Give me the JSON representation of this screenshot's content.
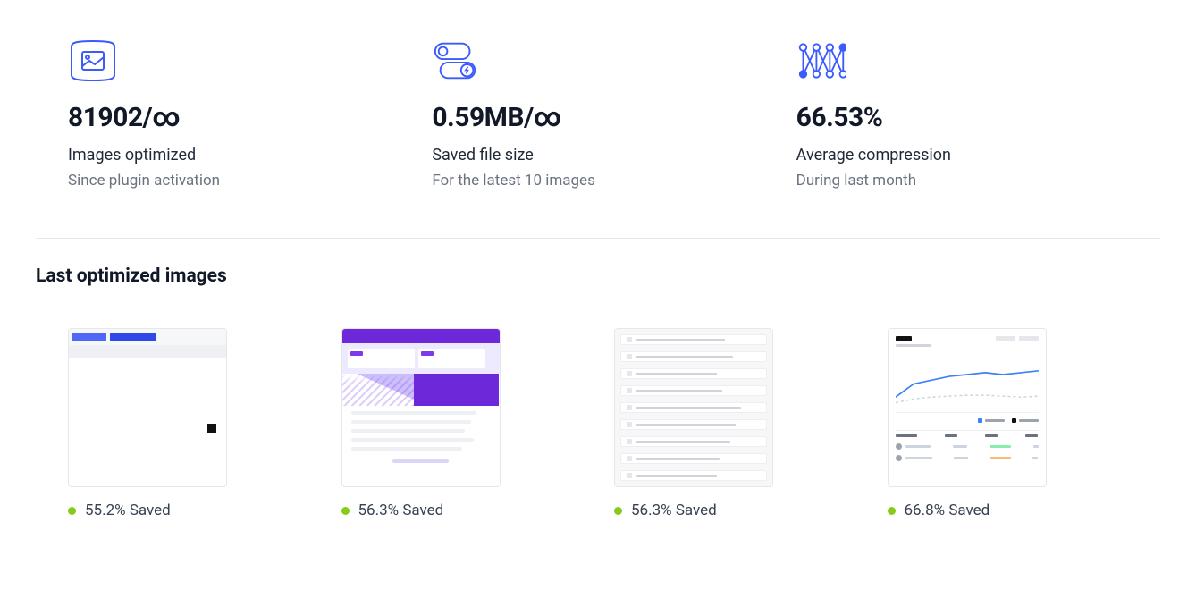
{
  "stats": [
    {
      "value": "81902/∞",
      "label": "Images optimized",
      "sub": "Since plugin activation",
      "icon": "image-panorama-icon"
    },
    {
      "value": "0.59MB/∞",
      "label": "Saved file size",
      "sub": "For the latest 10 images",
      "icon": "toggle-bolt-icon"
    },
    {
      "value": "66.53%",
      "label": "Average compression",
      "sub": "During last month",
      "icon": "neural-network-icon"
    }
  ],
  "section_title": "Last optimized images",
  "thumbnails": [
    {
      "saved": "55.2% Saved"
    },
    {
      "saved": "56.3% Saved"
    },
    {
      "saved": "56.3% Saved"
    },
    {
      "saved": "66.8% Saved"
    }
  ]
}
